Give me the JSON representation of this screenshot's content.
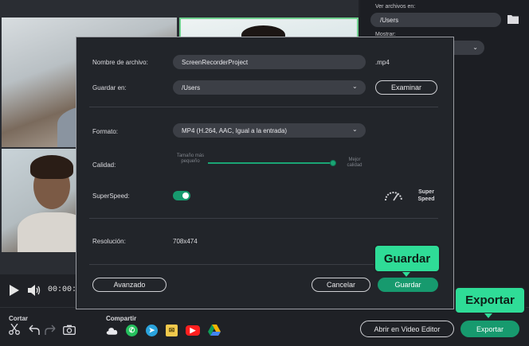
{
  "video": {
    "time_display": "00:00:0"
  },
  "right_panel": {
    "view_files_label": "Ver archivos en:",
    "path_value": "/Users",
    "show_label": "Mostrar:"
  },
  "dialog": {
    "filename_label": "Nombre de archivo:",
    "filename_value": "ScreenRecorderProject",
    "filename_ext": ".mp4",
    "save_in_label": "Guardar en:",
    "save_in_value": "/Users",
    "browse_button": "Examinar",
    "format_label": "Formato:",
    "format_value": "MP4 (H.264, AAC, Igual a la entrada)",
    "quality_label": "Calidad:",
    "quality_min_label": "Tamaño más pequeño",
    "quality_max_label": "Mejor calidad",
    "quality_level": 1.0,
    "superspeed_label": "SuperSpeed:",
    "superspeed_on": true,
    "superspeed_badge": "Super Speed",
    "resolution_label": "Resolución:",
    "resolution_value": "708x474",
    "advanced_button": "Avanzado",
    "cancel_button": "Cancelar",
    "save_button": "Guardar"
  },
  "tooltips": {
    "save": "Guardar",
    "export": "Exportar"
  },
  "bottom_bar": {
    "cut_label": "Cortar",
    "share_label": "Compartir",
    "open_editor_button": "Abrir en Video Editor",
    "export_button": "Exportar"
  },
  "colors": {
    "accent_green": "#179a6e",
    "tooltip_green": "#2fdc97"
  }
}
